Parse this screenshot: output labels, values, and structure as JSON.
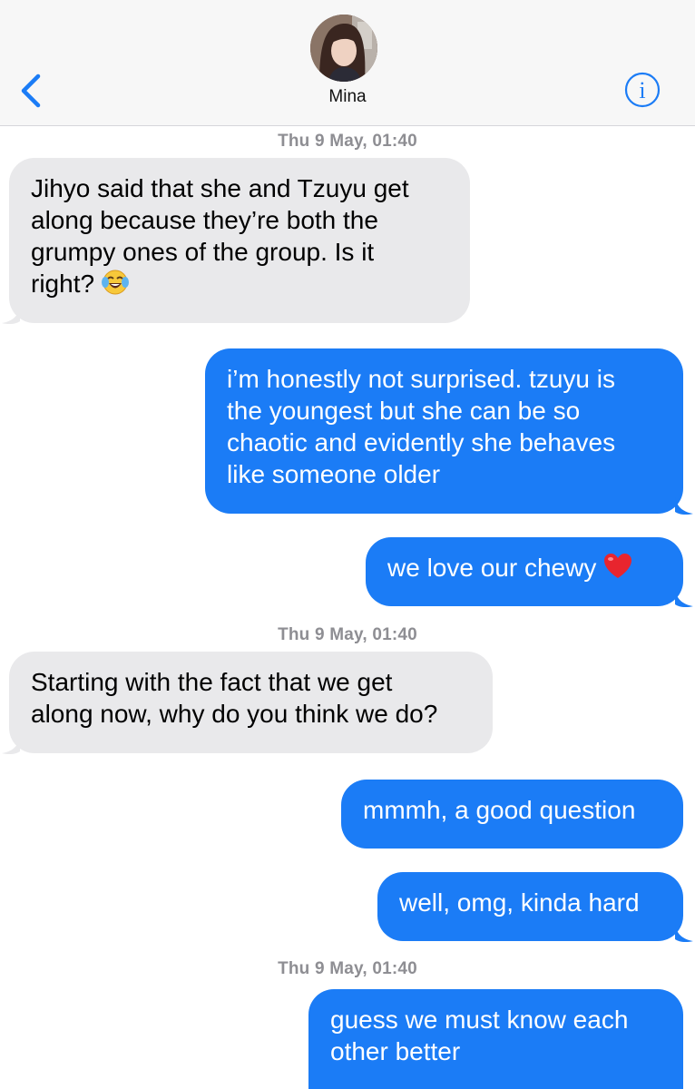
{
  "header": {
    "contact_name": "Mina",
    "back_icon": "chevron-left-icon",
    "info_icon": "info-icon"
  },
  "colors": {
    "accent": "#1b7cf6",
    "incoming_bubble": "#e9e9eb",
    "timestamp": "#8e8e93"
  },
  "timestamps": [
    "Thu 9 May, 01:40",
    "Thu 9 May, 01:40",
    "Thu 9 May, 01:40"
  ],
  "messages": [
    {
      "direction": "incoming",
      "lines": [
        "Jihyo said that she and Tzuyu get",
        "along because they’re both the",
        "grumpy ones of the group. Is it",
        "right?"
      ],
      "emoji": "face-with-tears-of-joy"
    },
    {
      "direction": "outgoing",
      "lines": [
        "i’m honestly not surprised. tzuyu is",
        "the youngest but she can be so",
        "chaotic and evidently she behaves",
        "like someone older"
      ]
    },
    {
      "direction": "outgoing",
      "lines": [
        "we love our chewy"
      ],
      "emoji": "red-heart"
    },
    {
      "direction": "incoming",
      "lines": [
        "Starting with the fact that we get",
        "along now, why do you think we do?"
      ]
    },
    {
      "direction": "outgoing",
      "lines": [
        "mmmh, a good question"
      ]
    },
    {
      "direction": "outgoing",
      "lines": [
        "well, omg, kinda hard"
      ]
    },
    {
      "direction": "outgoing",
      "lines": [
        "guess we must know each",
        "other better"
      ]
    }
  ]
}
